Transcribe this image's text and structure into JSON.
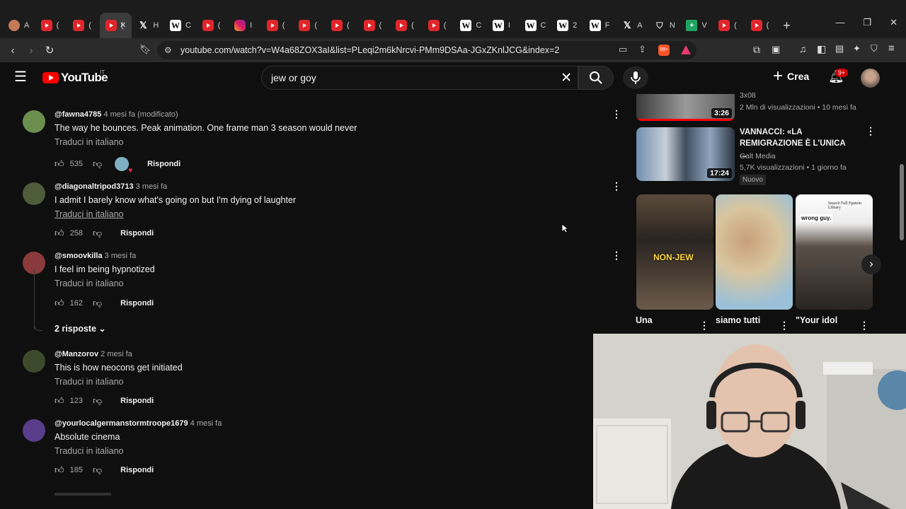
{
  "browser": {
    "tabs": [
      {
        "icon": "avatar-icon",
        "label": "A"
      },
      {
        "icon": "youtube-icon",
        "label": "("
      },
      {
        "icon": "youtube-icon",
        "label": "("
      },
      {
        "icon": "youtube-icon",
        "label": "(",
        "active": true
      },
      {
        "icon": "x-icon",
        "label": "H"
      },
      {
        "icon": "wikipedia-icon",
        "label": "C"
      },
      {
        "icon": "youtube-icon",
        "label": "("
      },
      {
        "icon": "instagram-icon",
        "label": "I"
      },
      {
        "icon": "youtube-icon",
        "label": "("
      },
      {
        "icon": "youtube-icon",
        "label": "("
      },
      {
        "icon": "youtube-icon",
        "label": "("
      },
      {
        "icon": "youtube-icon",
        "label": "("
      },
      {
        "icon": "youtube-icon",
        "label": "("
      },
      {
        "icon": "youtube-icon",
        "label": "("
      },
      {
        "icon": "wikipedia-icon",
        "label": "C"
      },
      {
        "icon": "wikipedia-icon",
        "label": "I"
      },
      {
        "icon": "wikipedia-icon",
        "label": "C"
      },
      {
        "icon": "wikipedia-icon",
        "label": "2"
      },
      {
        "icon": "wikipedia-icon",
        "label": "F"
      },
      {
        "icon": "x-icon",
        "label": "A"
      },
      {
        "icon": "shield-icon",
        "label": "N"
      },
      {
        "icon": "plus-green-icon",
        "label": "V"
      },
      {
        "icon": "youtube-icon",
        "label": "("
      },
      {
        "icon": "youtube-icon",
        "label": "("
      }
    ],
    "url": "youtube.com/watch?v=W4a68ZOX3aI&list=PLeqi2m6kNrcvi-PMm9DSAa-JGxZKnlJCG&index=2",
    "brave_badge": "99+"
  },
  "youtube": {
    "logo_text": "YouTube",
    "country": "IT",
    "search_query": "jew or goy",
    "create_label": "Crea",
    "notification_count": "9+"
  },
  "comments": [
    {
      "handle": "@fawna4785",
      "time": "4 mesi fa (modificato)",
      "text": "The way he bounces. Peak animation. One frame man 3 season would never",
      "translate": "Traduci in italiano",
      "likes": "535",
      "reply": "Rispondi",
      "creator_heart": true,
      "avatar_color": "#6b8f4e"
    },
    {
      "handle": "@diagonaltripod3713",
      "time": "3 mesi fa",
      "text": "I admit I barely know what's going on but I'm dying of laughter",
      "translate": "Traduci in italiano",
      "likes": "258",
      "reply": "Rispondi",
      "avatar_color": "#4e5c3a"
    },
    {
      "handle": "@smoovkilla",
      "time": "3 mesi fa",
      "text": "I feel im being hypnotized",
      "translate": "Traduci in italiano",
      "likes": "162",
      "reply": "Rispondi",
      "avatar_color": "#8a3a3a",
      "replies_label": "2 risposte"
    },
    {
      "handle": "@Manzorov",
      "time": "2 mesi fa",
      "text": "This is how neocons get initiated",
      "translate": "Traduci in italiano",
      "likes": "123",
      "reply": "Rispondi",
      "avatar_color": "#3d4a2c"
    },
    {
      "handle": "@yourlocalgermanstormtroope1679",
      "time": "4 mesi fa",
      "text": "Absolute cinema",
      "translate": "Traduci in italiano",
      "likes": "185",
      "reply": "Rispondi",
      "avatar_color": "#5a3d8a"
    }
  ],
  "sidebar": {
    "video_top": {
      "meta_partial": "3x08",
      "meta": "2 Mln di visualizzazioni • 10 mesi fa",
      "duration": "3:26"
    },
    "video_2": {
      "title": "VANNACCI: «LA REMIGRAZIONE È L'UNICA ...",
      "channel": "Galt Media",
      "meta": "5,7K visualizzazioni • 1 giorno fa",
      "badge": "Nuovo",
      "duration": "17:24"
    },
    "shorts": [
      {
        "title": "Una",
        "overlay": "NON-JEW"
      },
      {
        "title": "siamo tutti"
      },
      {
        "title": "\"Your idol",
        "overlay": "wrong guy.",
        "overlay2": "Search Full Epstein Library"
      }
    ]
  }
}
